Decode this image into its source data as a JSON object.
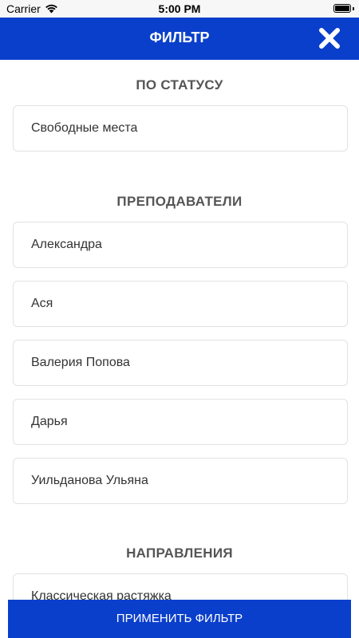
{
  "status_bar": {
    "carrier": "Carrier",
    "time": "5:00 PM",
    "wifi_icon": "wifi-icon",
    "battery_icon": "battery-icon"
  },
  "header": {
    "title": "ФИЛЬТР",
    "close_icon": "close-icon",
    "background": "#0a3fcb"
  },
  "sections": {
    "status": {
      "title": "ПО СТАТУСУ",
      "options": [
        "Свободные места"
      ]
    },
    "teachers": {
      "title": "ПРЕПОДАВАТЕЛИ",
      "options": [
        "Александра",
        "Ася",
        "Валерия Попова",
        "Дарья",
        "Уильданова Ульяна"
      ]
    },
    "directions": {
      "title": "НАПРАВЛЕНИЯ",
      "options": [
        "Классическая растяжка"
      ]
    }
  },
  "apply_button": {
    "label": "ПРИМЕНИТЬ ФИЛЬТР",
    "background": "#0a3fcb"
  }
}
